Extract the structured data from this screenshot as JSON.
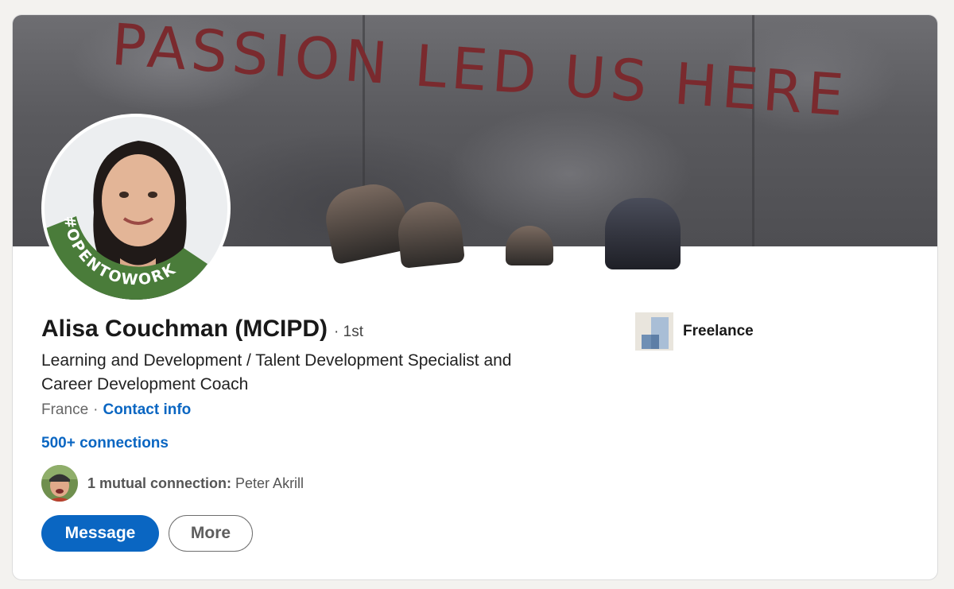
{
  "banner": {
    "text": "PASSION LED US HERE"
  },
  "profile": {
    "badge": "#OPENTOWORK",
    "name": "Alisa Couchman (MCIPD)",
    "degree": "· 1st",
    "headline_line1": "Learning and Development / Talent Development Specialist and",
    "headline_line2": "Career Development Coach",
    "location": "France",
    "separator": "·",
    "contact_info": "Contact info",
    "connections": "500+ connections"
  },
  "mutual": {
    "count_label": "1 mutual connection:",
    "name": "Peter Akrill"
  },
  "actions": {
    "message": "Message",
    "more": "More"
  },
  "company": {
    "name": "Freelance"
  },
  "colors": {
    "accent": "#0a66c2",
    "badge_green": "#4a7c3a",
    "banner_text": "#7a2a2e"
  },
  "icons": [
    "company-logo-icon",
    "avatar",
    "mutual-avatar"
  ]
}
